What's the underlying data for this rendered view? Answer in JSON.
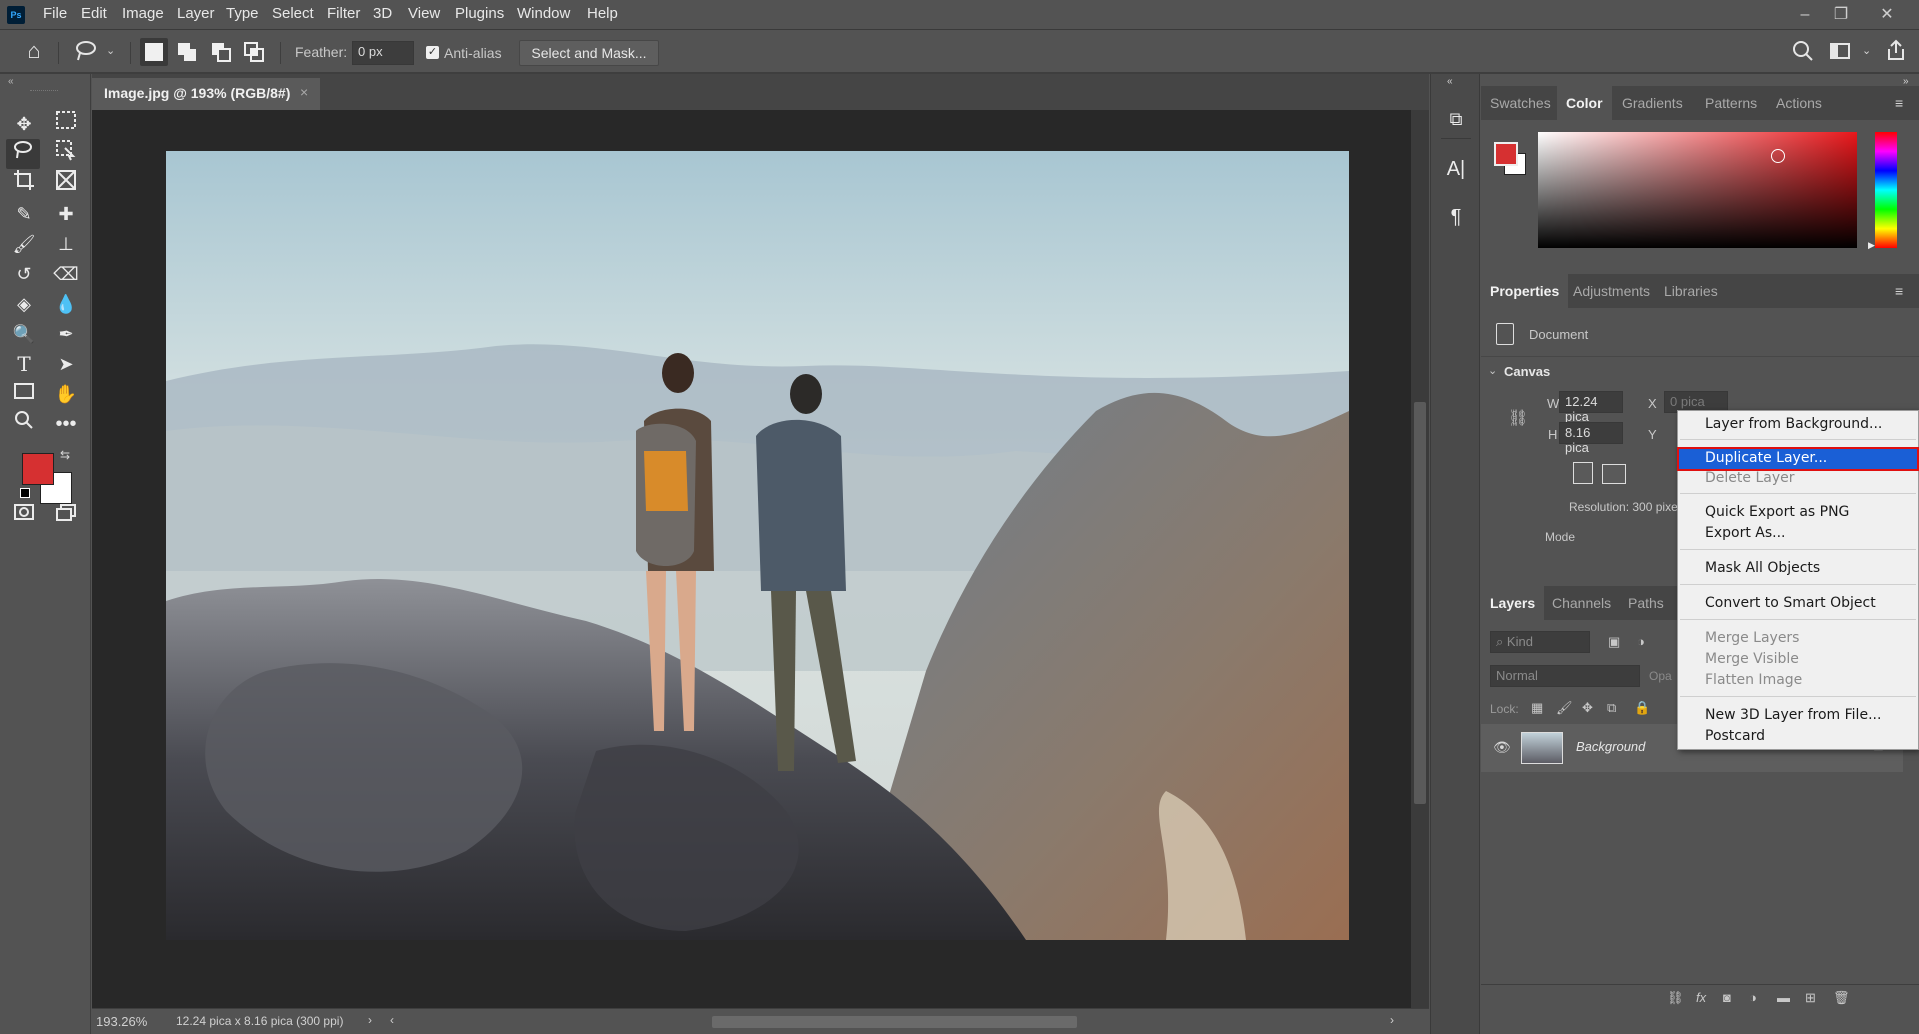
{
  "app_icon": "Ps",
  "menu": [
    "File",
    "Edit",
    "Image",
    "Layer",
    "Type",
    "Select",
    "Filter",
    "3D",
    "View",
    "Plugins",
    "Window",
    "Help"
  ],
  "options": {
    "feather_label": "Feather:",
    "feather_value": "0 px",
    "antialias_label": "Anti-alias",
    "select_mask_label": "Select and Mask..."
  },
  "document_tab": {
    "title": "Image.jpg @ 193% (RGB/8#)",
    "close": "×"
  },
  "status": {
    "zoom": "193.26%",
    "doc_info": "12.24 pica x 8.16 pica (300 ppi)"
  },
  "color_panel": {
    "tabs": [
      "Swatches",
      "Color",
      "Gradients",
      "Patterns",
      "Actions"
    ],
    "active_tab": "Color",
    "foreground": "#d63031",
    "background": "#ffffff"
  },
  "properties_panel": {
    "tabs": [
      "Properties",
      "Adjustments",
      "Libraries"
    ],
    "document_label": "Document",
    "canvas_label": "Canvas",
    "w_label": "W",
    "w_value": "12.24 pica",
    "h_label": "H",
    "h_value": "8.16 pica",
    "x_label": "X",
    "x_value": "0 pica",
    "y_label": "Y",
    "resolution": "Resolution: 300 pixe",
    "mode_label": "Mode"
  },
  "layers_panel": {
    "tabs": [
      "Layers",
      "Channels",
      "Paths"
    ],
    "kind_placeholder": "Kind",
    "blend_mode": "Normal",
    "opacity_label": "Opa",
    "lock_label": "Lock:",
    "layer_name": "Background"
  },
  "context_menu": {
    "items": [
      {
        "label": "Layer from Background...",
        "disabled": false
      },
      {
        "label": "Duplicate Layer...",
        "disabled": false,
        "highlighted": true
      },
      {
        "label": "Delete Layer",
        "disabled": true
      },
      {
        "label": "Quick Export as PNG",
        "disabled": false
      },
      {
        "label": "Export As...",
        "disabled": false
      },
      {
        "label": "Mask All Objects",
        "disabled": false
      },
      {
        "label": "Convert to Smart Object",
        "disabled": false
      },
      {
        "label": "Merge Layers",
        "disabled": true
      },
      {
        "label": "Merge Visible",
        "disabled": true
      },
      {
        "label": "Flatten Image",
        "disabled": true
      },
      {
        "label": "New 3D Layer from File...",
        "disabled": false
      },
      {
        "label": "Postcard",
        "disabled": false
      }
    ]
  },
  "colors": {
    "highlight": "#1a5fd6",
    "highlight_border": "#e01010",
    "ui_bg": "#535353"
  }
}
